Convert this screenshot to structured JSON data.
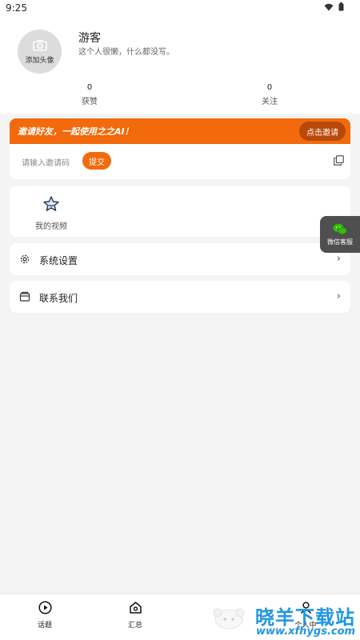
{
  "status_bar": {
    "time": "9:25"
  },
  "profile": {
    "avatar_label": "添加头像",
    "username": "游客",
    "bio": "这个人很懒，什么都没写。",
    "stats": [
      {
        "value": "0",
        "label": "获赞"
      },
      {
        "value": "0",
        "label": "关注"
      }
    ]
  },
  "invite": {
    "banner_text": "邀请好友，一起使用之之AI！",
    "invite_button": "点击邀请",
    "code_placeholder": "请输入邀请码",
    "submit_button": "提交"
  },
  "media": {
    "my_videos_label": "我的视频"
  },
  "settings_rows": [
    {
      "label": "系统设置",
      "icon": "gear-icon"
    },
    {
      "label": "联系我们",
      "icon": "contact-icon"
    }
  ],
  "float_button": {
    "label": "微信客服"
  },
  "bottom_nav": [
    {
      "label": "话题",
      "icon": "play-circle-icon"
    },
    {
      "label": "汇总",
      "icon": "home-icon"
    },
    {
      "label": "个人中",
      "icon": "person-icon"
    }
  ],
  "watermark": {
    "title": "晓羊下载站",
    "url": "www.xfhygs.com"
  },
  "colors": {
    "accent": "#f26a0c",
    "accent_dark": "#b8490a",
    "wechat_green": "#2dc100",
    "watermark_blue": "#2196e0"
  }
}
